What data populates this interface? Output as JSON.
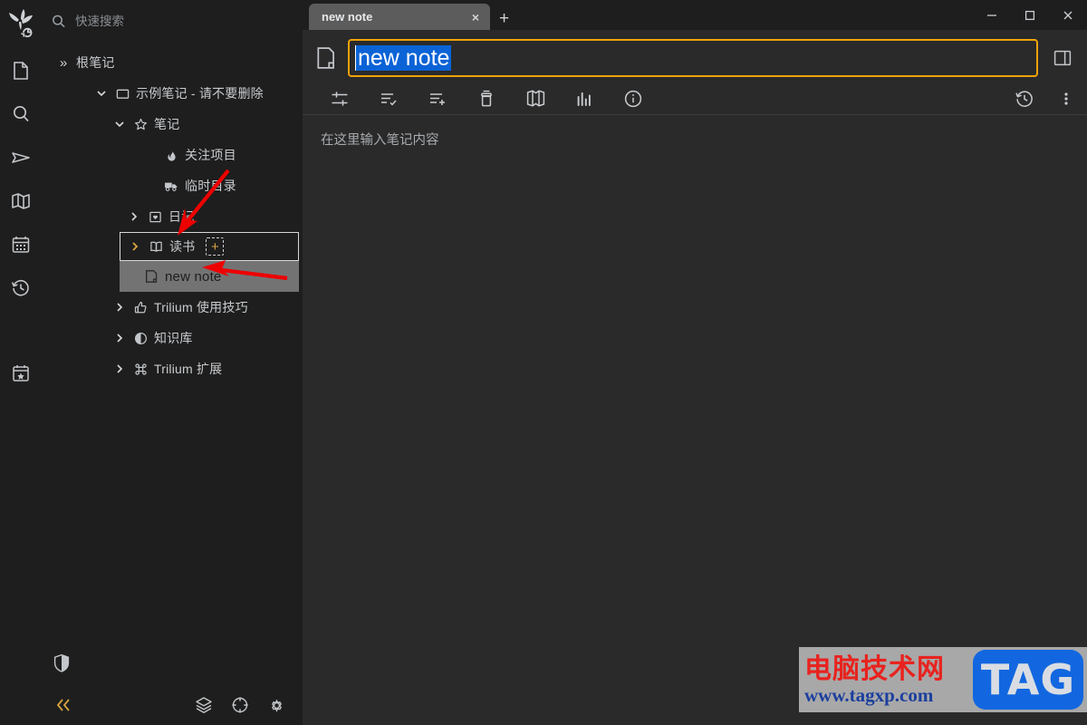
{
  "app": {
    "logo_icon": "trilium-leaf-logo",
    "sync_icon": "sync-icon"
  },
  "search": {
    "icon": "search-icon",
    "placeholder": "快速搜索",
    "value": ""
  },
  "rail": {
    "items": [
      {
        "icon": "note-page-icon",
        "name": "rail-item-notes"
      },
      {
        "icon": "search-icon",
        "name": "rail-item-search"
      },
      {
        "icon": "send-jump-icon",
        "name": "rail-item-jump-to"
      },
      {
        "icon": "map-icon",
        "name": "rail-item-note-map"
      },
      {
        "icon": "calendar-icon",
        "name": "rail-item-calendar"
      },
      {
        "icon": "history-clock-icon",
        "name": "rail-item-recent-changes"
      },
      {
        "icon": "calendar-star-icon",
        "name": "rail-item-bookmarks"
      }
    ],
    "shield_icon": "shield-icon"
  },
  "tree": {
    "root": {
      "label": "根笔记",
      "twisty": "»",
      "icon": ""
    },
    "items": [
      {
        "label": "示例笔记 - 请不要删除",
        "icon": "folder-icon",
        "twisty": "expanded",
        "indent": 0,
        "selected": false,
        "boxed": false,
        "plus": false
      },
      {
        "label": "笔记",
        "icon": "star-icon",
        "twisty": "expanded",
        "indent": 1,
        "selected": false,
        "boxed": false,
        "plus": false
      },
      {
        "label": "关注项目",
        "icon": "fire-icon",
        "twisty": "none",
        "indent": 2,
        "selected": false,
        "boxed": false,
        "plus": false
      },
      {
        "label": "临时目录",
        "icon": "truck-icon",
        "twisty": "none",
        "indent": 2,
        "selected": false,
        "boxed": false,
        "plus": false
      },
      {
        "label": "日记",
        "icon": "journal-icon",
        "twisty": "collapsed",
        "indent": 2,
        "selected": false,
        "boxed": false,
        "plus": false
      },
      {
        "label": "读书",
        "icon": "book-open-icon",
        "twisty": "collapsed",
        "indent": 2,
        "selected": false,
        "boxed": true,
        "plus": true,
        "plus_label": "+"
      },
      {
        "label": "new note",
        "icon": "note-page-icon",
        "twisty": "none",
        "indent": 3,
        "selected": true,
        "boxed": false,
        "plus": false
      },
      {
        "label": "Trilium 使用技巧",
        "icon": "thumbs-up-icon",
        "twisty": "collapsed",
        "indent": 1,
        "selected": false,
        "boxed": false,
        "plus": false
      },
      {
        "label": "知识库",
        "icon": "contrast-circle-icon",
        "twisty": "collapsed",
        "indent": 1,
        "selected": false,
        "boxed": false,
        "plus": false
      },
      {
        "label": "Trilium 扩展",
        "icon": "command-icon",
        "twisty": "collapsed",
        "indent": 1,
        "selected": false,
        "boxed": false,
        "plus": false
      }
    ]
  },
  "sidebar_footer": {
    "collapse_icon": "chevrons-left-icon",
    "collapse_label": "«",
    "buttons": [
      {
        "icon": "layers-icon",
        "name": "layers-button"
      },
      {
        "icon": "crosshair-icon",
        "name": "crosshair-button"
      },
      {
        "icon": "gear-icon",
        "name": "settings-button"
      }
    ]
  },
  "tabs": {
    "items": [
      {
        "title": "new note",
        "close_label": "×",
        "active": true
      }
    ],
    "add_label": "+"
  },
  "window_controls": {
    "minimize_label": "–",
    "maximize_label": "□",
    "close_label": "✕"
  },
  "note": {
    "type_icon": "note-page-icon",
    "title_value": "new note",
    "title_selected": true,
    "split_icon": "split-panel-icon"
  },
  "ribbon": {
    "buttons": [
      {
        "icon": "sliders-icon",
        "name": "ribbon-basic-properties"
      },
      {
        "icon": "list-check-icon",
        "name": "ribbon-owned-attributes"
      },
      {
        "icon": "list-plus-icon",
        "name": "ribbon-inherited-attributes"
      },
      {
        "icon": "archive-box-icon",
        "name": "ribbon-note-paths"
      },
      {
        "icon": "book-map-icon",
        "name": "ribbon-note-map"
      },
      {
        "icon": "bar-chart-icon",
        "name": "ribbon-note-info"
      },
      {
        "icon": "info-circle-icon",
        "name": "ribbon-similar-notes"
      }
    ],
    "right_buttons": [
      {
        "icon": "history-clock-icon",
        "name": "note-revisions-button"
      },
      {
        "icon": "vertical-dots-icon",
        "name": "note-actions-menu"
      }
    ]
  },
  "editor": {
    "placeholder": "在这里输入笔记内容"
  },
  "watermark": {
    "cn_text": "电脑技术网",
    "url_text": "www.tagxp.com",
    "tag_text": "TAG",
    "cn_color": "#e8231f",
    "url_color": "#1b3f9e",
    "tag_bg": "#1267e0"
  },
  "annotations": {
    "arrow_color": "#ee0000",
    "arrows": [
      {
        "name": "arrow-to-add-child-button"
      },
      {
        "name": "arrow-to-new-note-row"
      }
    ],
    "highlight_border_color": "#d7d9dc"
  },
  "theme": {
    "accent": "#f0a30a",
    "selection_blue": "#0b63d6",
    "sidebar_bg": "#1e1e1e",
    "main_bg": "#2a2a2a",
    "selected_row_bg": "#737373"
  }
}
